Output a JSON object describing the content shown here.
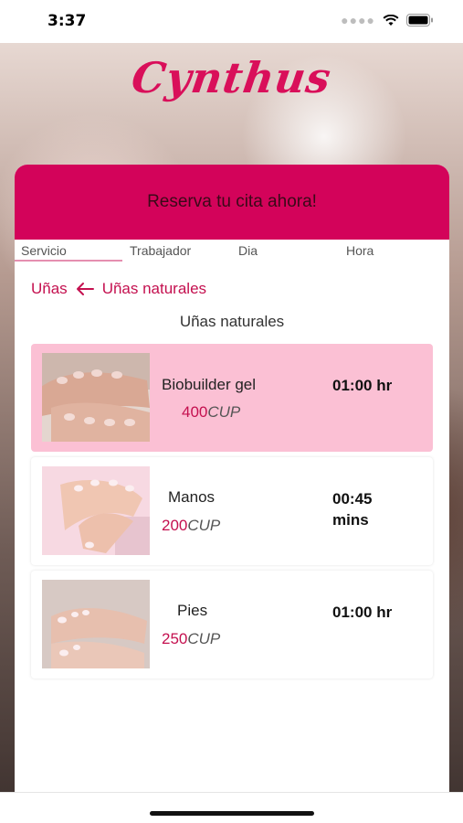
{
  "status_bar": {
    "time": "3:37"
  },
  "app": {
    "logo_text": "Cynthus",
    "brand_color": "#d3035a"
  },
  "header": {
    "title": "Reserva tu cita ahora!"
  },
  "tabs": [
    {
      "label": "Servicio",
      "active": true
    },
    {
      "label": "Trabajador",
      "active": false
    },
    {
      "label": "Dia",
      "active": false
    },
    {
      "label": "Hora",
      "active": false
    }
  ],
  "breadcrumb": {
    "parent": "Uñas",
    "current": "Uñas naturales",
    "icon": "arrow-left-icon"
  },
  "section": {
    "title": "Uñas naturales"
  },
  "services": [
    {
      "name": "Biobuilder gel",
      "price": "400",
      "currency": "CUP",
      "duration": "01:00 hr",
      "selected": true
    },
    {
      "name": "Manos",
      "price": "200",
      "currency": "CUP",
      "duration": "00:45 mins",
      "selected": false
    },
    {
      "name": "Pies",
      "price": "250",
      "currency": "CUP",
      "duration": "01:00 hr",
      "selected": false
    }
  ]
}
